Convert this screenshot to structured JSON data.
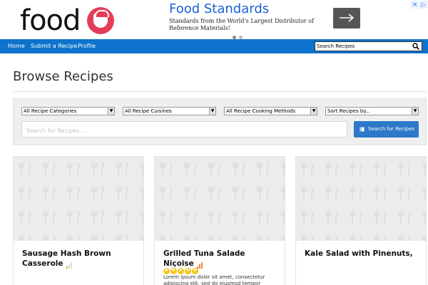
{
  "header": {
    "logo_text": "food",
    "ad": {
      "title": "Food Standards",
      "text": "Standards from the World's Largest Distributor of Reference Materials!",
      "arrow_icon": "arrow-right-icon"
    }
  },
  "nav": {
    "items": [
      {
        "label": "Home"
      },
      {
        "label": "Submit a Recipe"
      },
      {
        "label": "Profile"
      }
    ],
    "search_placeholder": "Search Recipes"
  },
  "page": {
    "title": "Browse Recipes"
  },
  "filters": {
    "categories": "All Recipe Categories",
    "cuisines": "All Recipe Cuisines",
    "methods": "All Recipe Cooking Methods",
    "sort": "Sort Recipes by...",
    "search_placeholder": "Search for Recipes ...",
    "search_button": "Search for Recipes"
  },
  "recipes": [
    {
      "title": "Sausage Hash Brown Casserole",
      "difficulty": "easy",
      "rating": 0,
      "description": ""
    },
    {
      "title": "Grilled Tuna Salade Niçoise",
      "difficulty": "hard",
      "rating": 5,
      "description": "Lorem ipsum dolor sit amet, consectetur adipiscing elit, sed do eiusmod tempor"
    },
    {
      "title": "Kale Salad with Pinenuts,",
      "difficulty": "",
      "rating": 0,
      "description": ""
    }
  ],
  "colors": {
    "nav_bg": "#0d73cc",
    "button_bg": "#2d78c8",
    "brand_red": "#e43d57",
    "star": "#f5c518",
    "difficulty_green": "#9ac63f",
    "difficulty_orange": "#f0842c"
  }
}
